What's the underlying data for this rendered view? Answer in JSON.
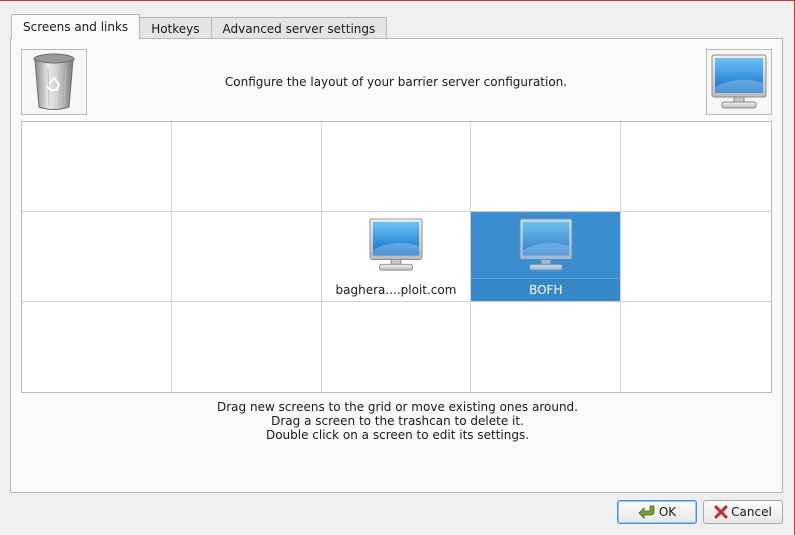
{
  "tabs": [
    {
      "label": "Screens and links",
      "active": true
    },
    {
      "label": "Hotkeys",
      "active": false
    },
    {
      "label": "Advanced server settings",
      "active": false
    }
  ],
  "header": {
    "text": "Configure the layout of your barrier server configuration.",
    "trash_icon": "trashcan-icon",
    "new_screen_icon": "monitor-icon"
  },
  "grid": {
    "rows": 3,
    "columns": 5,
    "screens": [
      {
        "label": "baghera....ploit.com",
        "row": 2,
        "col": 3,
        "selected": false,
        "icon": "monitor-icon"
      },
      {
        "label": "BOFH",
        "row": 2,
        "col": 4,
        "selected": true,
        "icon": "monitor-icon"
      }
    ]
  },
  "instructions": [
    "Drag new screens to the grid or move existing ones around.",
    "Drag a screen to the trashcan to delete it.",
    "Double click on a screen to edit its settings."
  ],
  "buttons": {
    "ok_label": "OK",
    "cancel_label": "Cancel"
  },
  "colors": {
    "selection": "#3a8ecf",
    "accent_border": "#d3343f"
  }
}
